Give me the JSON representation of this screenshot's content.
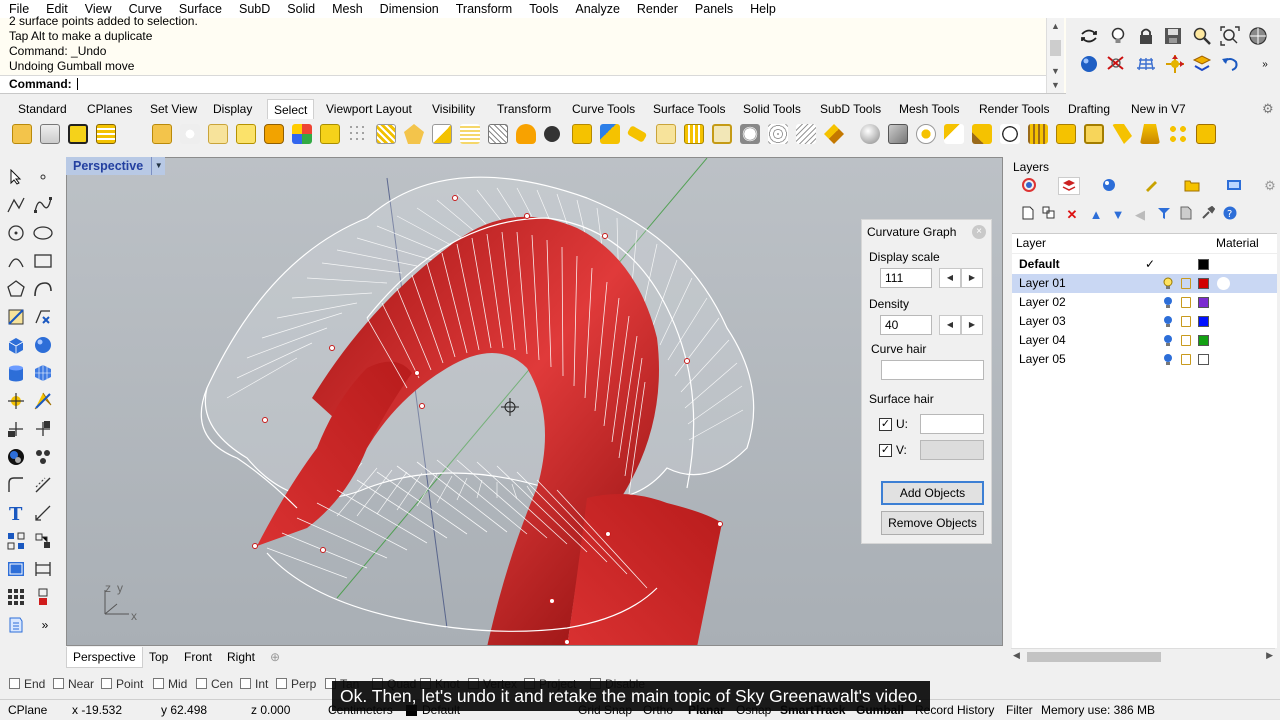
{
  "menu": [
    "File",
    "Edit",
    "View",
    "Curve",
    "Surface",
    "SubD",
    "Solid",
    "Mesh",
    "Dimension",
    "Transform",
    "Tools",
    "Analyze",
    "Render",
    "Panels",
    "Help"
  ],
  "command": {
    "history": [
      "2 surface points added to selection.",
      "Tap Alt to make a duplicate",
      "Command: _Undo",
      "Undoing Gumball move"
    ],
    "prompt_label": "Command:",
    "input_value": ""
  },
  "toolbar_tabs": [
    "Standard",
    "CPlanes",
    "Set View",
    "Display",
    "Select",
    "Viewport Layout",
    "Visibility",
    "Transform",
    "Curve Tools",
    "Surface Tools",
    "Solid Tools",
    "SubD Tools",
    "Mesh Tools",
    "Render Tools",
    "Drafting",
    "New in V7"
  ],
  "active_toolbar_tab": "Select",
  "viewport": {
    "title": "Perspective",
    "axis_y": "y",
    "axis_z": "z",
    "axis_x": "x"
  },
  "curvature_graph": {
    "title": "Curvature Graph",
    "display_scale_label": "Display scale",
    "display_scale_value": "111",
    "density_label": "Density",
    "density_value": "40",
    "curve_hair_label": "Curve hair",
    "surface_hair_label": "Surface hair",
    "u_label": "U:",
    "v_label": "V:",
    "add_button": "Add Objects",
    "remove_button": "Remove Objects"
  },
  "layers_panel": {
    "title": "Layers",
    "header_layer": "Layer",
    "header_material": "Material",
    "rows": [
      {
        "name": "Default",
        "current": "✓",
        "color": "#000000"
      },
      {
        "name": "Layer 01",
        "color": "#d10000"
      },
      {
        "name": "Layer 02",
        "color": "#7b2bd0"
      },
      {
        "name": "Layer 03",
        "color": "#0010ff"
      },
      {
        "name": "Layer 04",
        "color": "#12a012"
      },
      {
        "name": "Layer 05",
        "color": "#ffffff"
      }
    ]
  },
  "viewport_tabs": [
    "Perspective",
    "Top",
    "Front",
    "Right"
  ],
  "viewport_tab_add": "⊕",
  "osnaps": [
    "End",
    "Near",
    "Point",
    "Mid",
    "Cen",
    "Int",
    "Perp",
    "Tan",
    "Quad",
    "Knot",
    "Vertex",
    "Project",
    "Disable"
  ],
  "status": {
    "cplane": "CPlane",
    "x": "x -19.532",
    "y": "y 62.498",
    "z": "z 0.000",
    "units": "Centimeters",
    "layer": "Default",
    "grid_snap": "Grid Snap",
    "ortho": "Ortho",
    "planar": "Planar",
    "osnap": "Osnap",
    "smarttrack": "SmartTrack",
    "gumball": "Gumball",
    "record_history": "Record History",
    "filter": "Filter",
    "memory": "Memory use: 386 MB"
  },
  "caption": "Ok. Then, let's undo it and retake the main topic of Sky Greenawalt's video."
}
